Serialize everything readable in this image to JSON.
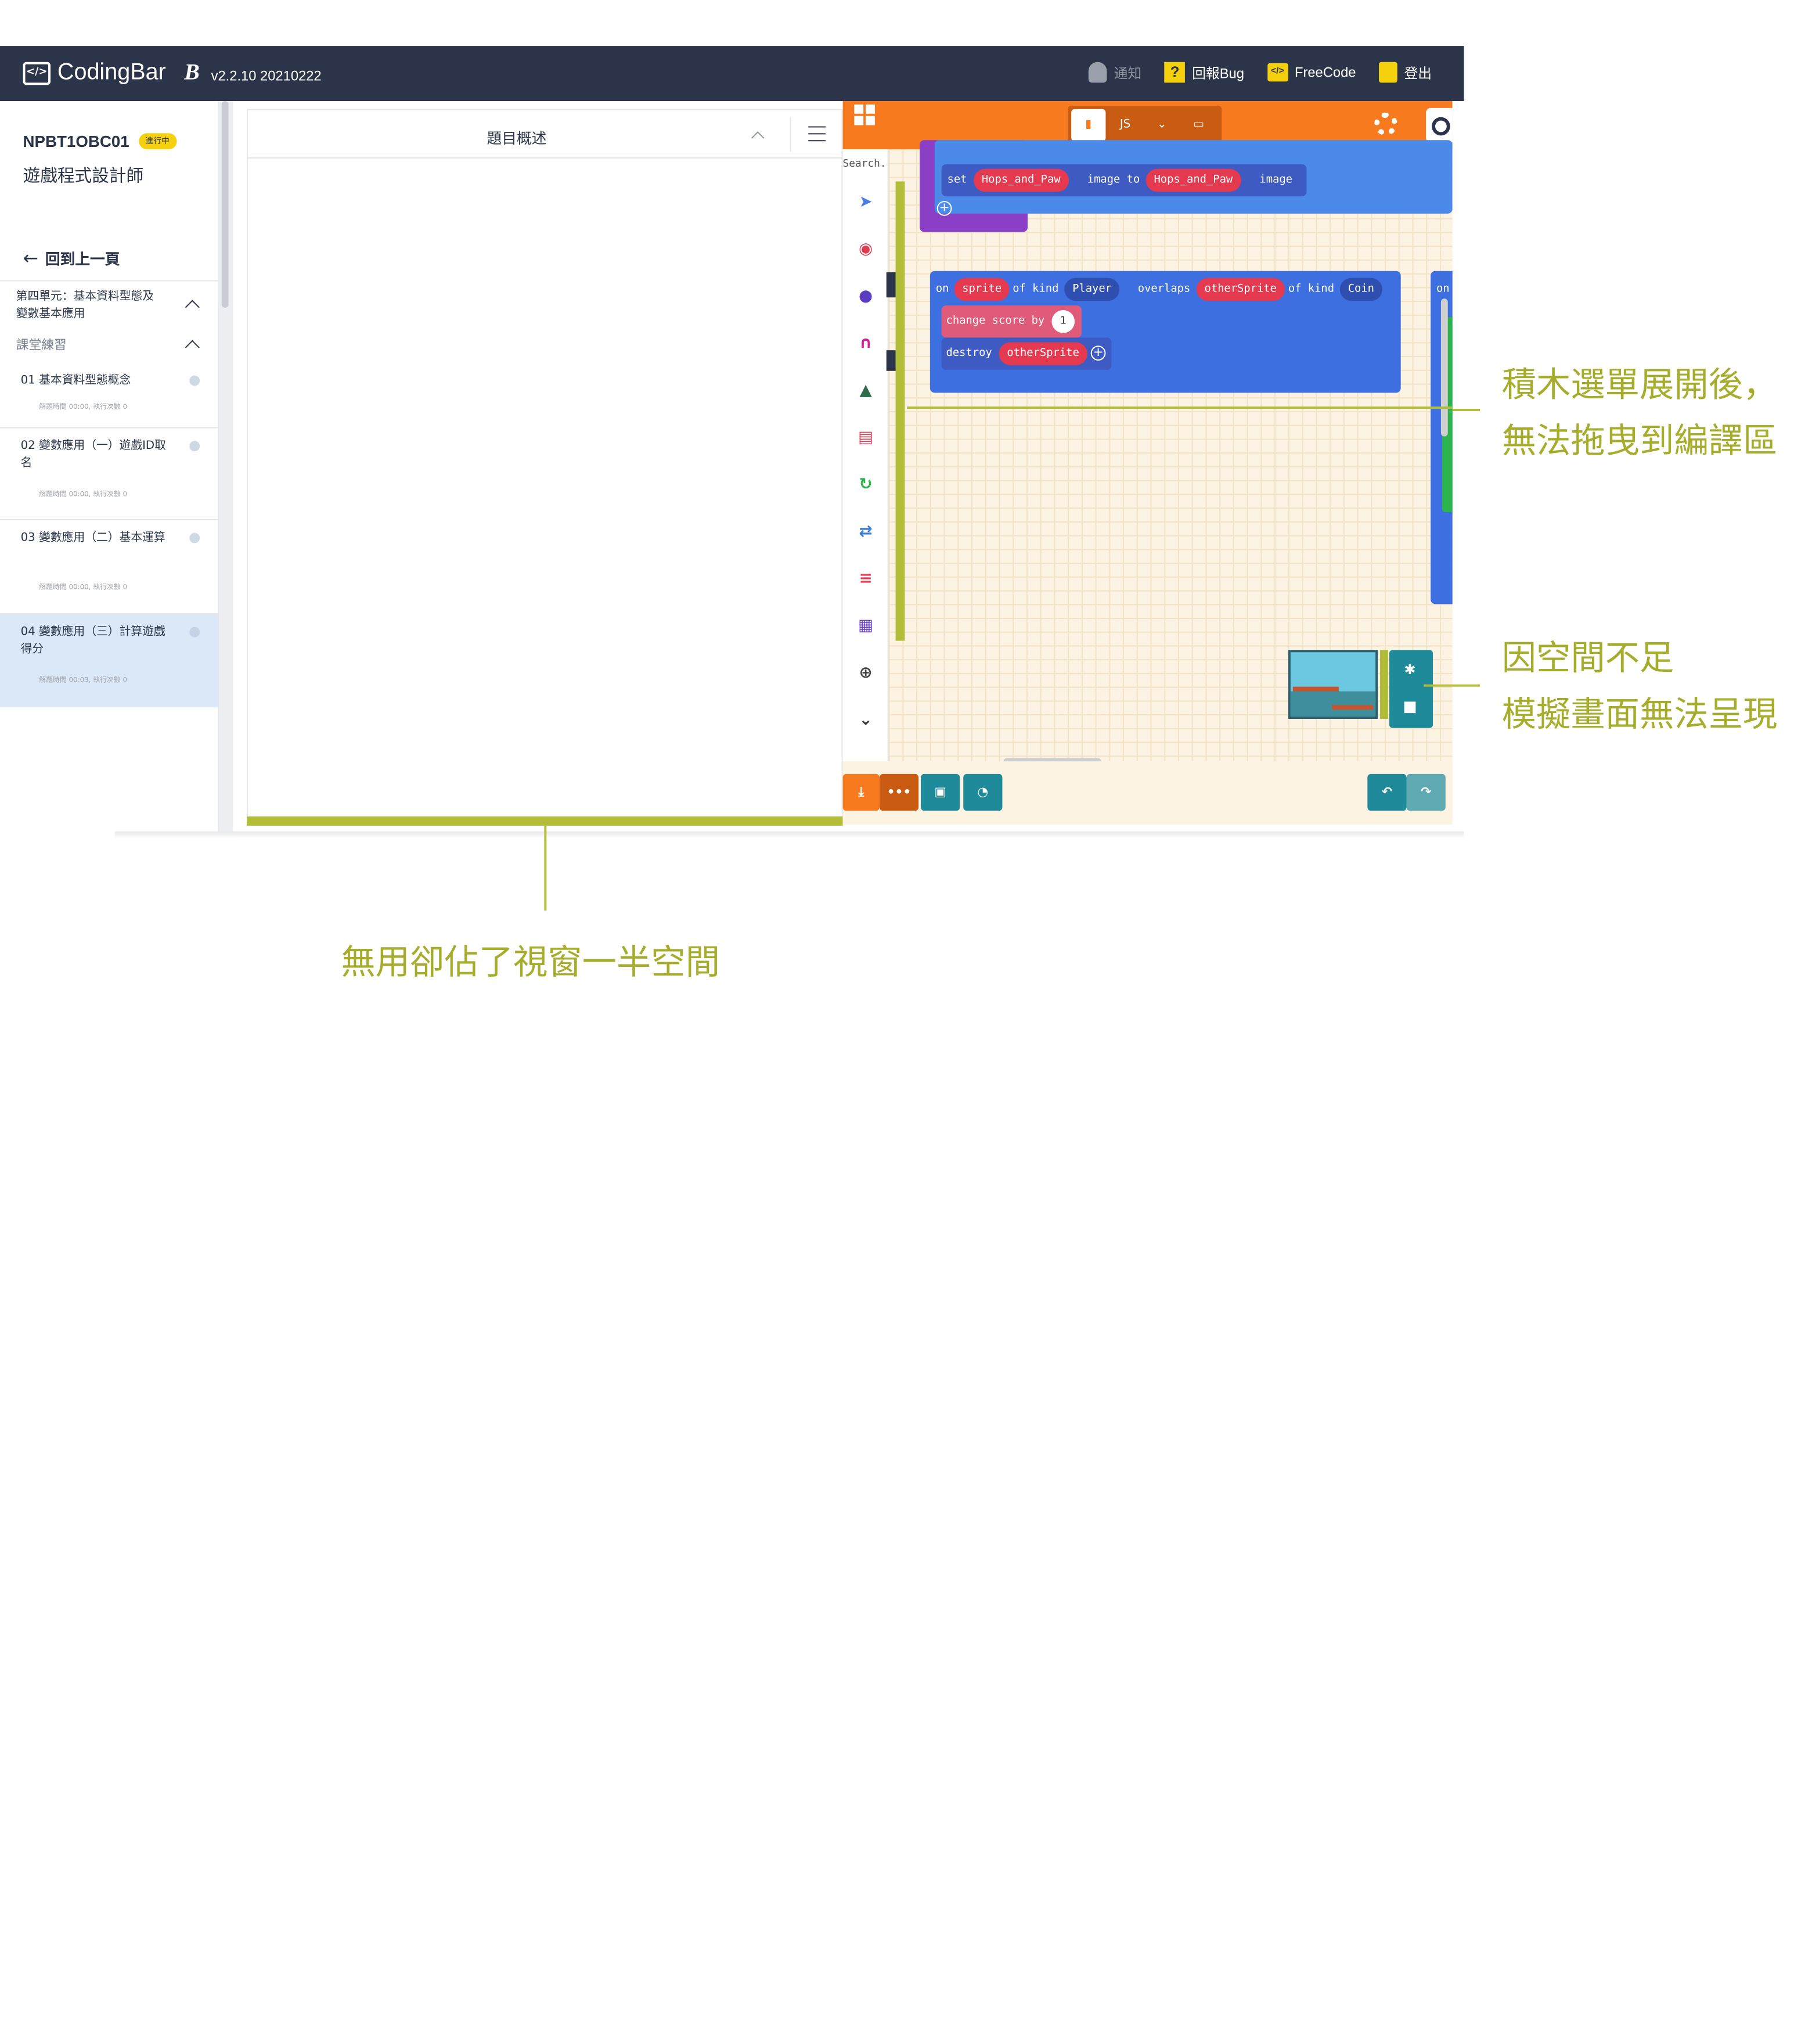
{
  "header": {
    "brand": "CodingBar",
    "brand_mark": "B",
    "version": "v2.2.10 20210222",
    "nav": {
      "notify": "通知",
      "report_bug": "回報Bug",
      "freecode": "FreeCode",
      "logout": "登出"
    }
  },
  "sidebar": {
    "course_code": "NPBT1OBC01",
    "status_badge": "進行中",
    "course_name": "遊戲程式設計師",
    "back_label": "回到上一頁",
    "unit_title": "第四單元：基本資料型態及變數基本應用",
    "section_label": "課堂練習",
    "lessons": [
      {
        "num": "01",
        "title": "基本資料型態概念",
        "meta": "解題時間 00:00, 執行次數 0"
      },
      {
        "num": "02",
        "title": "變數應用（一）遊戲ID取名",
        "meta": "解題時間 00:00, 執行次數 0"
      },
      {
        "num": "03",
        "title": "變數應用（二）基本運算",
        "meta": "解題時間 00:00, 執行次數 0"
      },
      {
        "num": "04",
        "title": "變數應用（三）計算遊戲得分",
        "meta": "解題時間 00:03, 執行次數 0"
      }
    ]
  },
  "panel": {
    "title": "題目概述"
  },
  "editor": {
    "search_placeholder": "Search...",
    "blocks": {
      "set": "set",
      "set_var": "Hops_and_Paw",
      "image_to": "image to",
      "image_var": "Hops_and_Paw",
      "image": "image",
      "on": "on",
      "sprite": "sprite",
      "of_kind": "of kind",
      "player": "Player",
      "overlaps": "overlaps",
      "other_sprite": "otherSprite",
      "of_kind2": "of kind",
      "coin": "Coin",
      "change_score": "change score by",
      "change_value": "1",
      "destroy": "destroy",
      "destroy_target": "otherSprite",
      "on_right": "on"
    },
    "colors": {
      "topbar": "#f77a1f",
      "workspace": "#fdf3e2",
      "event_block": "#3d6fe0",
      "variable_pill": "#e4394f",
      "sim_controls": "#1f8a99"
    }
  },
  "annotations": {
    "a1_line1": "積木選單展開後，",
    "a1_line2": "無法拖曳到編譯區",
    "a2_line1": "因空間不足",
    "a2_line2": "模擬畫面無法呈現",
    "a3": "無用卻佔了視窗一半空間"
  }
}
